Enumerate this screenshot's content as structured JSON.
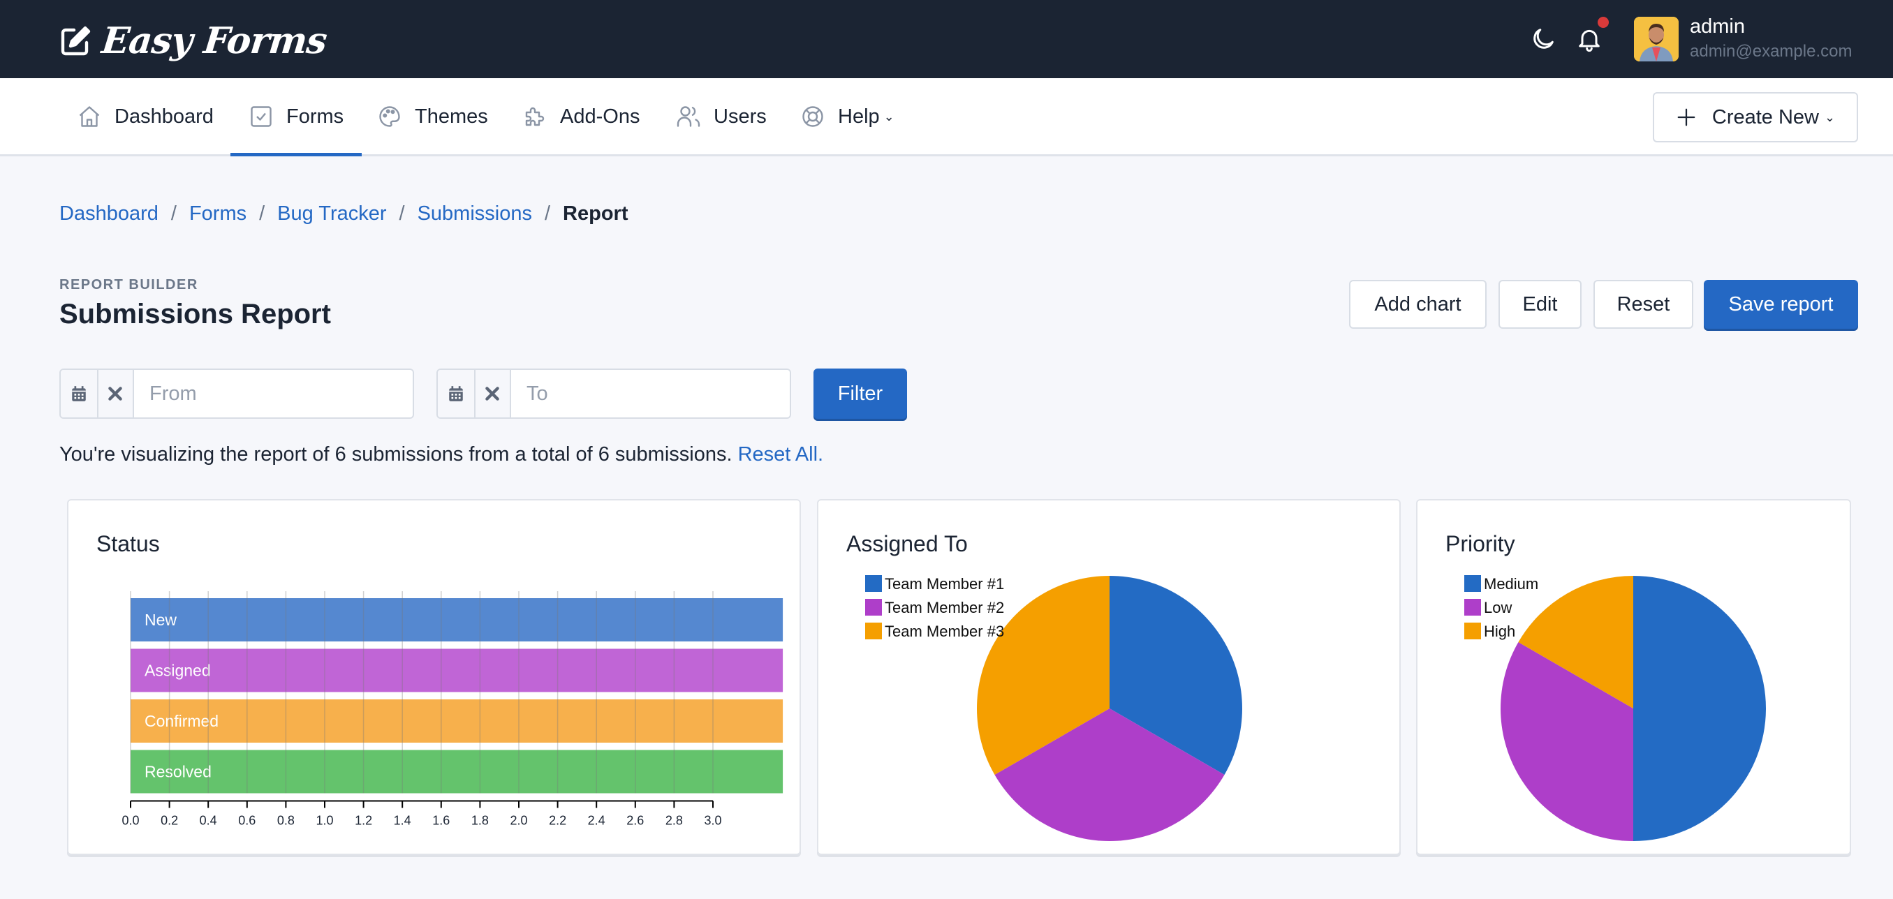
{
  "app": {
    "brand": "Easy Forms",
    "user": {
      "name": "admin",
      "email": "admin@example.com"
    },
    "icons": {
      "theme_toggle": "moon-icon",
      "notifications": "bell-icon",
      "has_unread_notifications": true
    }
  },
  "nav": {
    "items": [
      {
        "label": "Dashboard",
        "icon": "home-icon",
        "active": false
      },
      {
        "label": "Forms",
        "icon": "check-square-icon",
        "active": true
      },
      {
        "label": "Themes",
        "icon": "palette-icon",
        "active": false
      },
      {
        "label": "Add-Ons",
        "icon": "puzzle-icon",
        "active": false
      },
      {
        "label": "Users",
        "icon": "users-icon",
        "active": false
      },
      {
        "label": "Help",
        "icon": "lifebuoy-icon",
        "active": false,
        "has_dropdown": true
      }
    ],
    "create_new": "Create New"
  },
  "breadcrumb": [
    {
      "label": "Dashboard",
      "link": true
    },
    {
      "label": "Forms",
      "link": true
    },
    {
      "label": "Bug Tracker",
      "link": true
    },
    {
      "label": "Submissions",
      "link": true
    },
    {
      "label": "Report",
      "link": false
    }
  ],
  "header": {
    "eyebrow": "REPORT BUILDER",
    "title": "Submissions Report",
    "buttons": {
      "add_chart": "Add chart",
      "edit": "Edit",
      "reset": "Reset",
      "save": "Save report"
    }
  },
  "filters": {
    "from": {
      "value": "",
      "placeholder": "From"
    },
    "to": {
      "value": "",
      "placeholder": "To"
    },
    "filter_label": "Filter"
  },
  "info": {
    "text": "You're visualizing the report of 6 submissions from a total of 6 submissions.",
    "reset_link": "Reset All."
  },
  "colors": {
    "primary": "#2468c4",
    "topbar": "#1b2433",
    "series_blue": "#236bc4",
    "series_purple": "#ae3ec9",
    "series_orange": "#f59f00",
    "bar_blue": "#5588d0",
    "bar_purple": "#c065d6",
    "bar_orange": "#f7b04c",
    "bar_green": "#64c36c"
  },
  "chart_data": [
    {
      "type": "bar",
      "orientation": "horizontal",
      "title": "Status",
      "categories": [
        "New",
        "Assigned",
        "Confirmed",
        "Resolved"
      ],
      "values": [
        3.36,
        3.36,
        3.36,
        3.36
      ],
      "colors": [
        "#5588d0",
        "#c065d6",
        "#f7b04c",
        "#64c36c"
      ],
      "xlabel": "",
      "ylabel": "",
      "xlim": [
        0,
        3.0
      ],
      "xticks": [
        "0.0",
        "0.2",
        "0.4",
        "0.6",
        "0.8",
        "1.0",
        "1.2",
        "1.4",
        "1.6",
        "1.8",
        "2.0",
        "2.2",
        "2.4",
        "2.6",
        "2.8",
        "3.0"
      ],
      "grid": true,
      "note": "bars extend past the last axis tick"
    },
    {
      "type": "pie",
      "title": "Assigned To",
      "labels": [
        "Team Member #1",
        "Team Member #2",
        "Team Member #3"
      ],
      "values": [
        2,
        2,
        2
      ],
      "colors": [
        "#236bc4",
        "#ae3ec9",
        "#f59f00"
      ],
      "legend": "top-left"
    },
    {
      "type": "pie",
      "title": "Priority",
      "labels": [
        "Medium",
        "Low",
        "High"
      ],
      "values": [
        3,
        2,
        1
      ],
      "colors": [
        "#236bc4",
        "#ae3ec9",
        "#f59f00"
      ],
      "legend": "top-left"
    }
  ]
}
